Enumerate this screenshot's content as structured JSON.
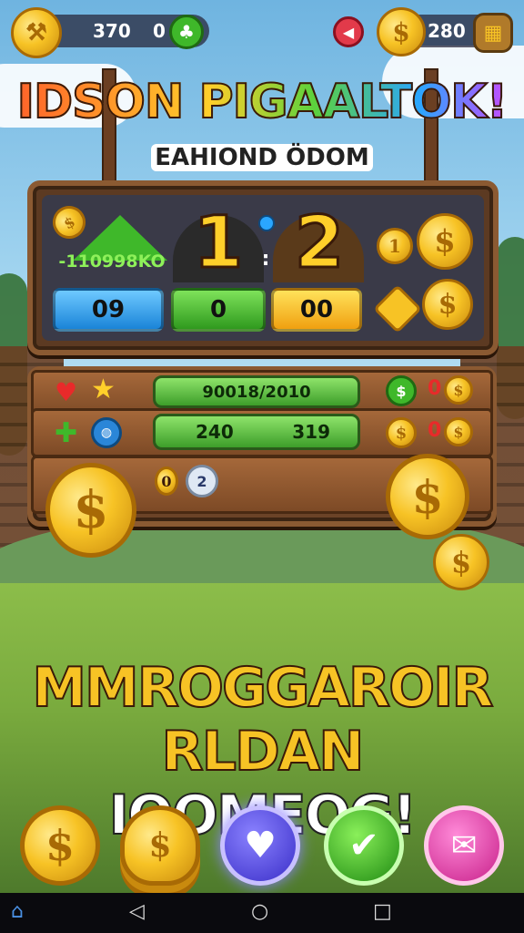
{
  "top_bar": {
    "counter_1": "370",
    "counter_2": "0",
    "coins": "280"
  },
  "title": {
    "main": "IDSON PIGAALTOK!",
    "subtitle": "EAHIOND ÖDOM"
  },
  "scoreboard": {
    "left_value": "-110998KO",
    "score_left": "1",
    "separator": ":",
    "score_right": "2",
    "blue_button": "09",
    "green_button": "0",
    "yellow_button": "00",
    "side_top": "1"
  },
  "stats": {
    "row1_bar": "90018/2010",
    "row1_count": "0",
    "row2_left": "240",
    "row2_right": "319",
    "row2_count": "0",
    "row3_left": "0",
    "row3_right": "2"
  },
  "promo": {
    "line1": "MMROGGAROIR",
    "line2_yellow": "RLDAN",
    "line2_white": "IOOMEOG!"
  },
  "colors": {
    "accent_gold": "#f7c325",
    "board_wood": "#5c3a22",
    "blue": "#2aa6ff",
    "green": "#3fb82a",
    "purple": "#5a4ee0",
    "pink": "#e83aa8"
  },
  "icons": {
    "top_left": "hammer-icon",
    "clover": "clover-icon",
    "shield": "shield-icon",
    "menu": "grid-menu-icon",
    "heart": "heart-icon",
    "star": "star-icon",
    "home_nav": "home-icon",
    "back_nav": "back-icon",
    "recent_nav": "recents-icon"
  }
}
